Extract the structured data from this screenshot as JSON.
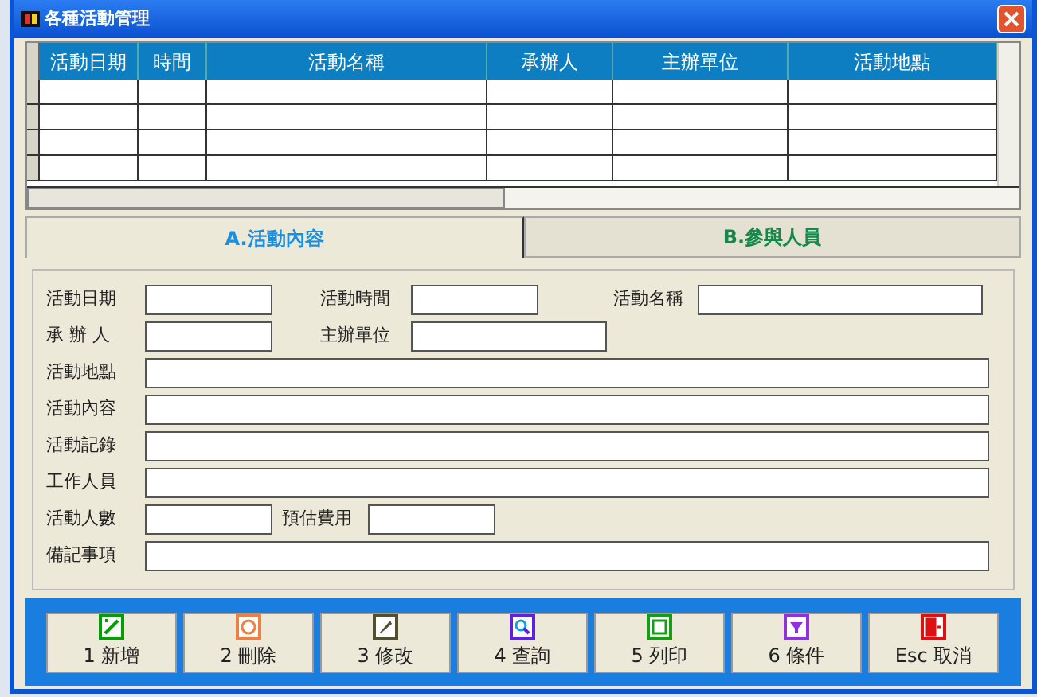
{
  "window": {
    "title": "各種活動管理"
  },
  "table": {
    "columns": [
      "活動日期",
      "時間",
      "活動名稱",
      "承辦人",
      "主辦單位",
      "活動地點"
    ]
  },
  "tabs": [
    {
      "label": "A.活動內容",
      "selected": true
    },
    {
      "label": "B.參與人員",
      "selected": false
    }
  ],
  "form": {
    "rows": [
      [
        {
          "label": "活動日期"
        },
        {
          "label": "活動時間"
        },
        {
          "label": "活動名稱"
        }
      ],
      [
        {
          "label": "承 辦 人"
        },
        {
          "label": "主辦單位"
        }
      ],
      [
        {
          "label": "活動地點"
        }
      ],
      [
        {
          "label": "活動內容"
        }
      ],
      [
        {
          "label": "活動記錄"
        }
      ],
      [
        {
          "label": "工作人員"
        }
      ],
      [
        {
          "label": "活動人數"
        },
        {
          "label": "預估費用"
        }
      ],
      [
        {
          "label": "備記事項"
        }
      ]
    ]
  },
  "buttons": [
    {
      "label": "1 新增"
    },
    {
      "label": "2 刪除"
    },
    {
      "label": "3 修改"
    },
    {
      "label": "4 查詢"
    },
    {
      "label": "5 列印"
    },
    {
      "label": "6 條件"
    },
    {
      "label": "Esc 取消"
    }
  ]
}
